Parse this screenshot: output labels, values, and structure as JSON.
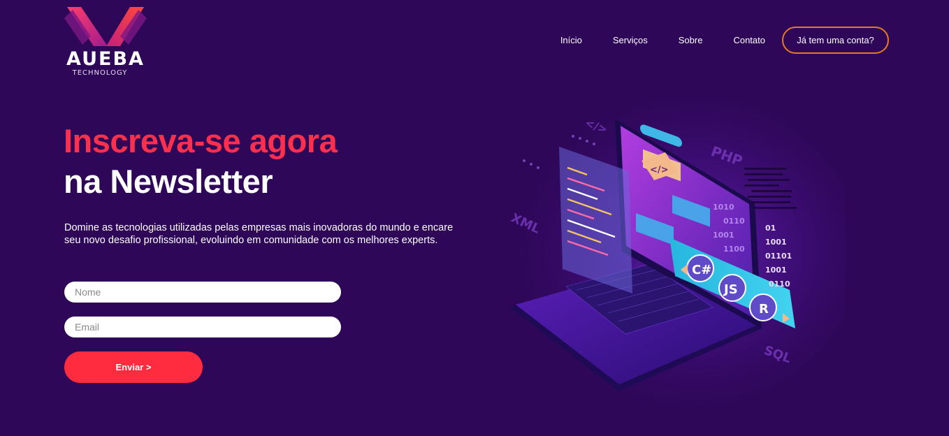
{
  "brand": {
    "name": "AUEBA",
    "tagline": "TECHNOLOGY"
  },
  "nav": {
    "items": [
      {
        "label": "Início"
      },
      {
        "label": "Serviços"
      },
      {
        "label": "Sobre"
      },
      {
        "label": "Contato"
      }
    ],
    "account_label": "Já tem uma conta?"
  },
  "hero": {
    "title_line1": "Inscreva-se agora",
    "title_line2": "na Newsletter",
    "description": "Domine as tecnologias utilizadas pelas empresas mais inovadoras do mundo e encare seu novo desafio profissional, evoluindo em comunidade com os melhores experts."
  },
  "form": {
    "name_placeholder": "Nome",
    "email_placeholder": "Email",
    "submit_label": "Enviar >"
  },
  "illustration": {
    "languages": [
      "C#",
      "JS",
      "R"
    ],
    "floating_labels": [
      "PHP",
      "XML",
      "SQL",
      "</>"
    ],
    "code_symbol": "</>"
  },
  "colors": {
    "background": "#2e0758",
    "accent_red": "#ff2f4e",
    "button_red": "#ff2c40",
    "outline_orange": "#e9781f"
  }
}
